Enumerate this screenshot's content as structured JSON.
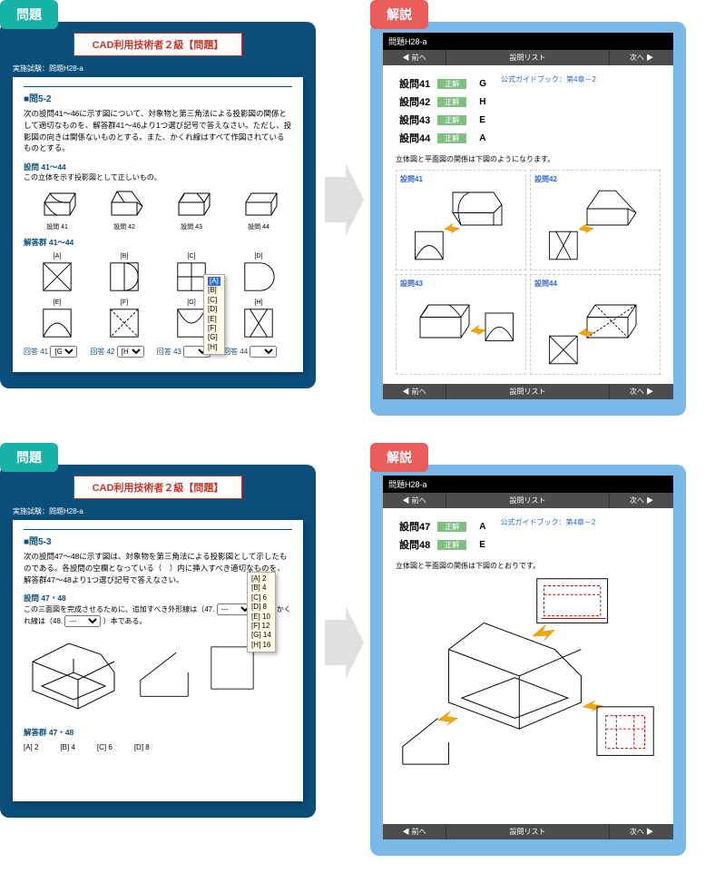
{
  "tags": {
    "problem": "問題",
    "answer": "解説"
  },
  "problem1": {
    "header": "CAD利用技術者２級【問題】",
    "breadcrumb": "実施試験：問題H28-a",
    "title": "■問5-2",
    "text": "次の設問41～46に示す図について、対象物と第三角法による投影図の関係として適切なものを、解答群41～46より1つ選び記号で答えなさい。ただし、投影図の向きは関係ないものとする。また、かくれ線はすべて作図されているものとする。",
    "sub_title": "設問 41～44",
    "sub_text": "この立体を示す投影図として正しいもの。",
    "shapes": [
      "設問 41",
      "設問 42",
      "設問 43",
      "設問 44"
    ],
    "group_label": "解答群 41～44",
    "group_labels_row1": [
      "[A]",
      "[B]",
      "[C]",
      "[D]"
    ],
    "group_labels_row2": [
      "[E]",
      "[F]",
      "[G]",
      "[H]"
    ],
    "answers": [
      "回答 41",
      "回答 42",
      "回答 43",
      "回答 44"
    ],
    "answer_vals": [
      "[G]",
      "[H]",
      "",
      ""
    ],
    "dropdown_opts": [
      "[A]",
      "[B]",
      "[C]",
      "[D]",
      "[E]",
      "[F]",
      "[G]",
      "[H]"
    ]
  },
  "answer1": {
    "topbar": "問題H28-a",
    "nav_prev": "◀ 前へ",
    "nav_list": "設問リスト",
    "nav_next": "次へ ▶",
    "rows": [
      {
        "q": "設問41",
        "badge": "正解",
        "val": "G"
      },
      {
        "q": "設問42",
        "badge": "正解",
        "val": "H"
      },
      {
        "q": "設問43",
        "badge": "正解",
        "val": "E"
      },
      {
        "q": "設問44",
        "badge": "正解",
        "val": "A"
      }
    ],
    "ref": "公式ガイドブック：第4章－2",
    "note": "立体図と平面図の関係は下図のようになります。",
    "cells": [
      "設問41",
      "設問42",
      "設問43",
      "設問44"
    ]
  },
  "problem2": {
    "header": "CAD利用技術者２級【問題】",
    "breadcrumb": "実施試験：問題H28-a",
    "title": "■問5-3",
    "text": "次の設問47～48に示す図は、対象物を第三角法による投影図として示したものである。各設問の空欄となっている（　）内に挿入すべき適切なものを、解答群47～48より1つ選び記号で答えなさい。",
    "sub_title": "設問 47・48",
    "sub_text_parts": [
      "この三面図を完成させるために、追加すべき外形線は（47.",
      "）本、かくれ線は（48.",
      "）本である。"
    ],
    "group_label": "解答群 47・48",
    "answers_row": [
      "[A] 2",
      "[B] 4",
      "[C] 6",
      "[D] 8"
    ],
    "dropdown_opts": [
      "[A] 2",
      "[B] 4",
      "[C] 6",
      "[D] 8",
      "[E] 10",
      "[F] 12",
      "[G] 14",
      "[H] 16"
    ]
  },
  "answer2": {
    "topbar": "問題H28-a",
    "nav_prev": "◀ 前へ",
    "nav_list": "設問リスト",
    "nav_next": "次へ ▶",
    "rows": [
      {
        "q": "設問47",
        "badge": "正解",
        "val": "A"
      },
      {
        "q": "設問48",
        "badge": "正解",
        "val": "E"
      }
    ],
    "ref": "公式ガイドブック：第4章－2",
    "note": "立体図と平面図の関係は下図のとおりです。"
  }
}
